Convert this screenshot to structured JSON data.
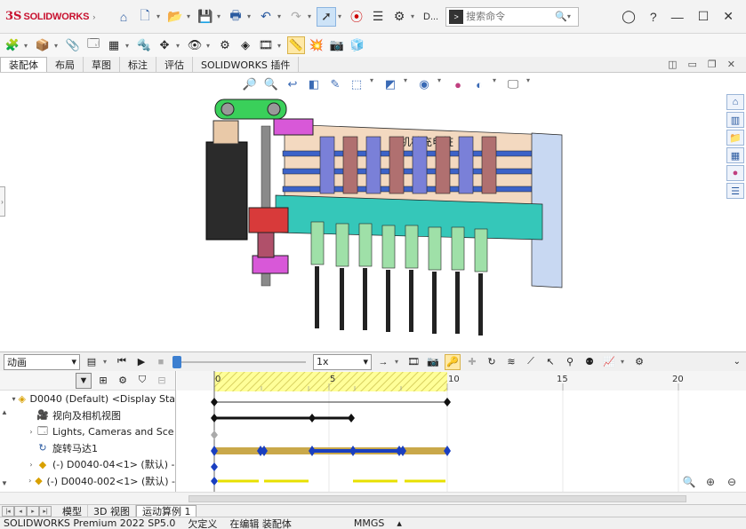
{
  "app": {
    "brand_ds": "3S",
    "brand_name": "SOLIDWORKS",
    "doc_short": "D...",
    "search_placeholder": "搜索命令"
  },
  "command_tabs": [
    "装配体",
    "布局",
    "草图",
    "标注",
    "评估",
    "SOLIDWORKS 插件"
  ],
  "motion": {
    "study_type": "动画",
    "speed": "1x",
    "tree": [
      {
        "label": "D0040 (Default) <Display Sta",
        "expander": "▾",
        "icon": "assembly-icon"
      },
      {
        "label": "视向及相机视图",
        "expander": "",
        "icon": "camera-view-icon"
      },
      {
        "label": "Lights, Cameras and Sce",
        "expander": "›",
        "icon": "lights-scene-icon"
      },
      {
        "label": "旋转马达1",
        "expander": "",
        "icon": "rotary-motor-icon"
      },
      {
        "label": "(-) D0040-04<1> (默认) -",
        "expander": "›",
        "icon": "part-icon"
      },
      {
        "label": "(-) D0040-002<1> (默认) -",
        "expander": "›",
        "icon": "part-icon"
      }
    ],
    "time_ticks": [
      "0",
      "5",
      "10",
      "15",
      "20"
    ]
  },
  "bottom_tabs": [
    "模型",
    "3D 视图",
    "运动算例 1"
  ],
  "status": {
    "product": "SOLIDWORKS Premium 2022 SP5.0",
    "under_defined": "欠定义",
    "editing": "在编辑 装配体",
    "units": "MMGS"
  },
  "model_label": "机械充电桩",
  "colors": {
    "accent_blue": "#2a5aa0",
    "timeline_bar": "#c9a84a",
    "timeline_highlight": "#ffff99",
    "key_blue": "#1a3fc0"
  }
}
